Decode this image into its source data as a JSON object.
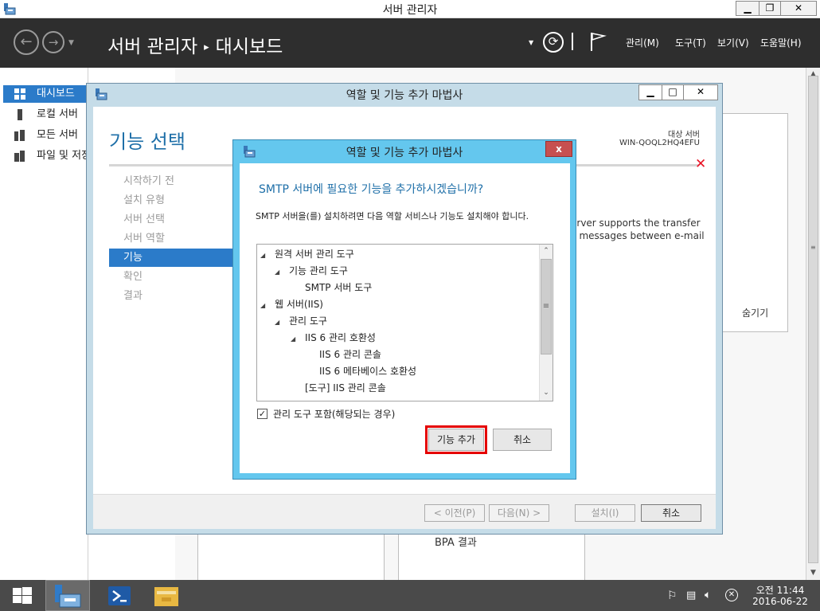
{
  "server_manager": {
    "title": "서버 관리자",
    "breadcrumb_app": "서버 관리자",
    "breadcrumb_page": "대시보드",
    "menu": {
      "manage": "관리(M)",
      "tools": "도구(T)",
      "view": "보기(V)",
      "help": "도움말(H)"
    },
    "sidebar": [
      {
        "label": "대시보드",
        "icon": "dashboard-icon",
        "active": true
      },
      {
        "label": "로컬 서버",
        "icon": "local-server-icon",
        "active": false
      },
      {
        "label": "모든 서버",
        "icon": "all-servers-icon",
        "active": false
      },
      {
        "label": "파일 및 저장소 서비스",
        "icon": "file-storage-icon",
        "active": false
      }
    ],
    "background": {
      "bpa_results": "BPA 결과"
    }
  },
  "wizard": {
    "title": "역할 및 기능 추가 마법사",
    "heading": "기능 선택",
    "target_label": "대상 서버",
    "target_name": "WIN-QOQL2HQ4EFU",
    "steps": [
      "시작하기 전",
      "설치 유형",
      "서버 선택",
      "서버 역할",
      "기능",
      "확인",
      "결과"
    ],
    "active_step": 4,
    "desc_fragment": [
      "erver supports the transfer",
      "il messages between e-mail",
      "."
    ],
    "hide_link": "숨기기",
    "buttons": {
      "prev": "< 이전(P)",
      "next": "다음(N) >",
      "install": "설치(I)",
      "cancel": "취소"
    }
  },
  "dialog": {
    "title": "역할 및 기능 추가 마법사",
    "close": "x",
    "question": "SMTP 서버에 필요한 기능을 추가하시겠습니까?",
    "description": "SMTP 서버을(를) 설치하려면 다음 역할 서비스나 기능도 설치해야 합니다.",
    "tree": [
      {
        "label": "원격 서버 관리 도구",
        "depth": 0,
        "expanded": true
      },
      {
        "label": "기능 관리 도구",
        "depth": 1,
        "expanded": true
      },
      {
        "label": "SMTP 서버 도구",
        "depth": 2,
        "expanded": false
      },
      {
        "label": "웹 서버(IIS)",
        "depth": 0,
        "expanded": true
      },
      {
        "label": "관리 도구",
        "depth": 1,
        "expanded": true
      },
      {
        "label": "IIS 6 관리 호환성",
        "depth": 2,
        "expanded": true
      },
      {
        "label": "IIS 6 관리 콘솔",
        "depth": 3,
        "expanded": false
      },
      {
        "label": "IIS 6 메타베이스 호환성",
        "depth": 3,
        "expanded": false
      },
      {
        "label": "[도구] IIS 관리 콘솔",
        "depth": 2,
        "expanded": false
      }
    ],
    "checkbox_label": "관리 도구 포함(해당되는 경우)",
    "checkbox_checked": true,
    "add_button": "기능 추가",
    "cancel_button": "취소"
  },
  "taskbar": {
    "time": "오전 11:44",
    "date": "2016-06-22"
  },
  "colors": {
    "accent_blue": "#2b7bc9",
    "dialog_frame": "#64c7ee",
    "highlight_red": "#e50000"
  }
}
